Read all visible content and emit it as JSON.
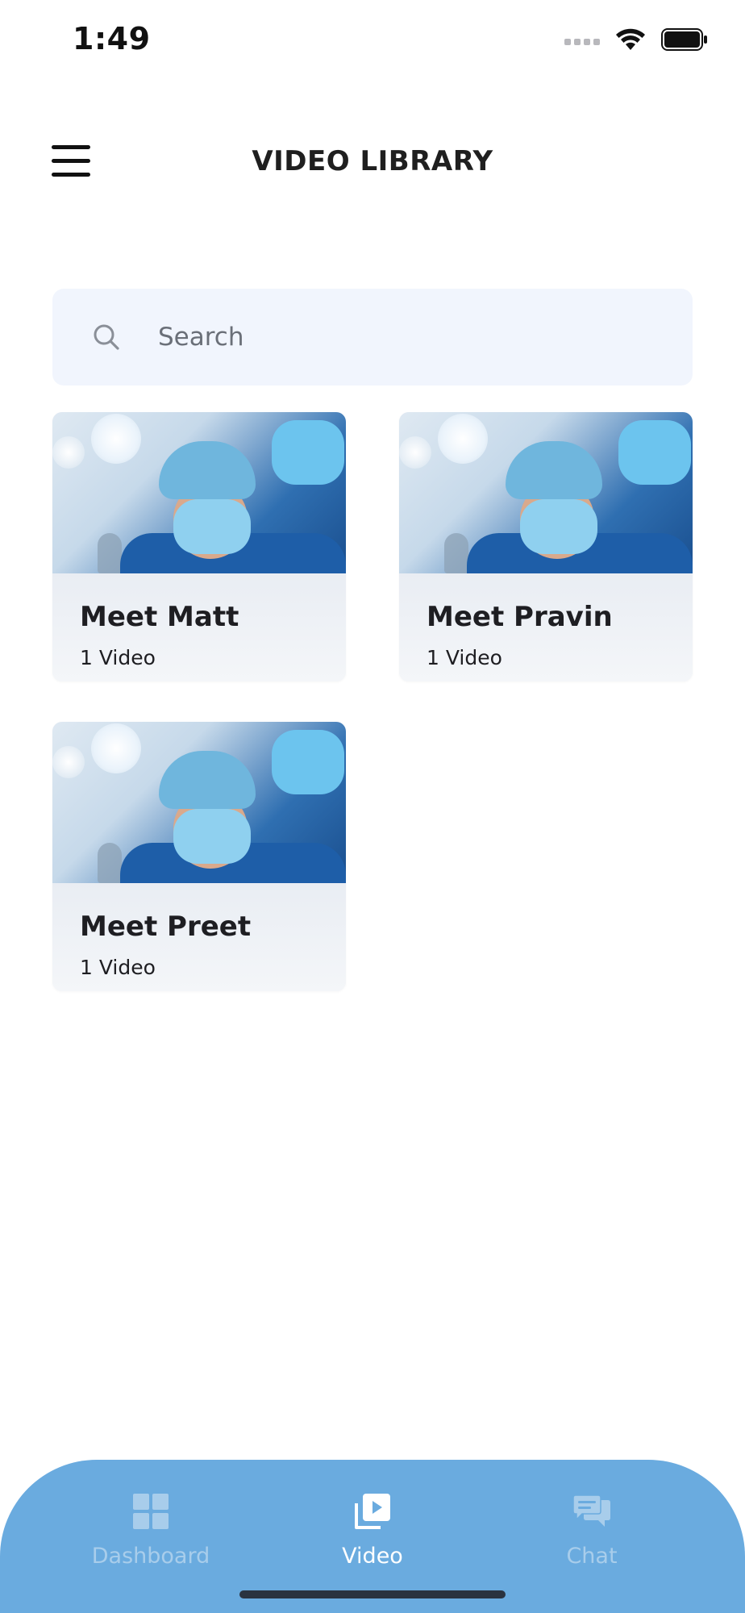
{
  "status_bar": {
    "time": "1:49"
  },
  "header": {
    "title": "VIDEO LIBRARY",
    "menu_icon": "hamburger-menu-icon"
  },
  "search": {
    "placeholder": "Search",
    "value": "",
    "icon": "search-icon"
  },
  "library": {
    "cards": [
      {
        "name": "Meet Matt",
        "count": "1 Video"
      },
      {
        "name": "Meet Pravin",
        "count": "1 Video"
      },
      {
        "name": "Meet Preet",
        "count": "1 Video"
      }
    ]
  },
  "bottom_nav": {
    "items": [
      {
        "label": "Dashboard",
        "icon": "dashboard-grid-icon",
        "active": false
      },
      {
        "label": "Video",
        "icon": "video-library-icon",
        "active": true
      },
      {
        "label": "Chat",
        "icon": "chat-bubbles-icon",
        "active": false
      }
    ]
  },
  "colors": {
    "nav_background": "#6aabdf",
    "nav_active": "#ffffff",
    "nav_inactive": "#a8cdeb",
    "search_background": "#f1f5fd"
  }
}
